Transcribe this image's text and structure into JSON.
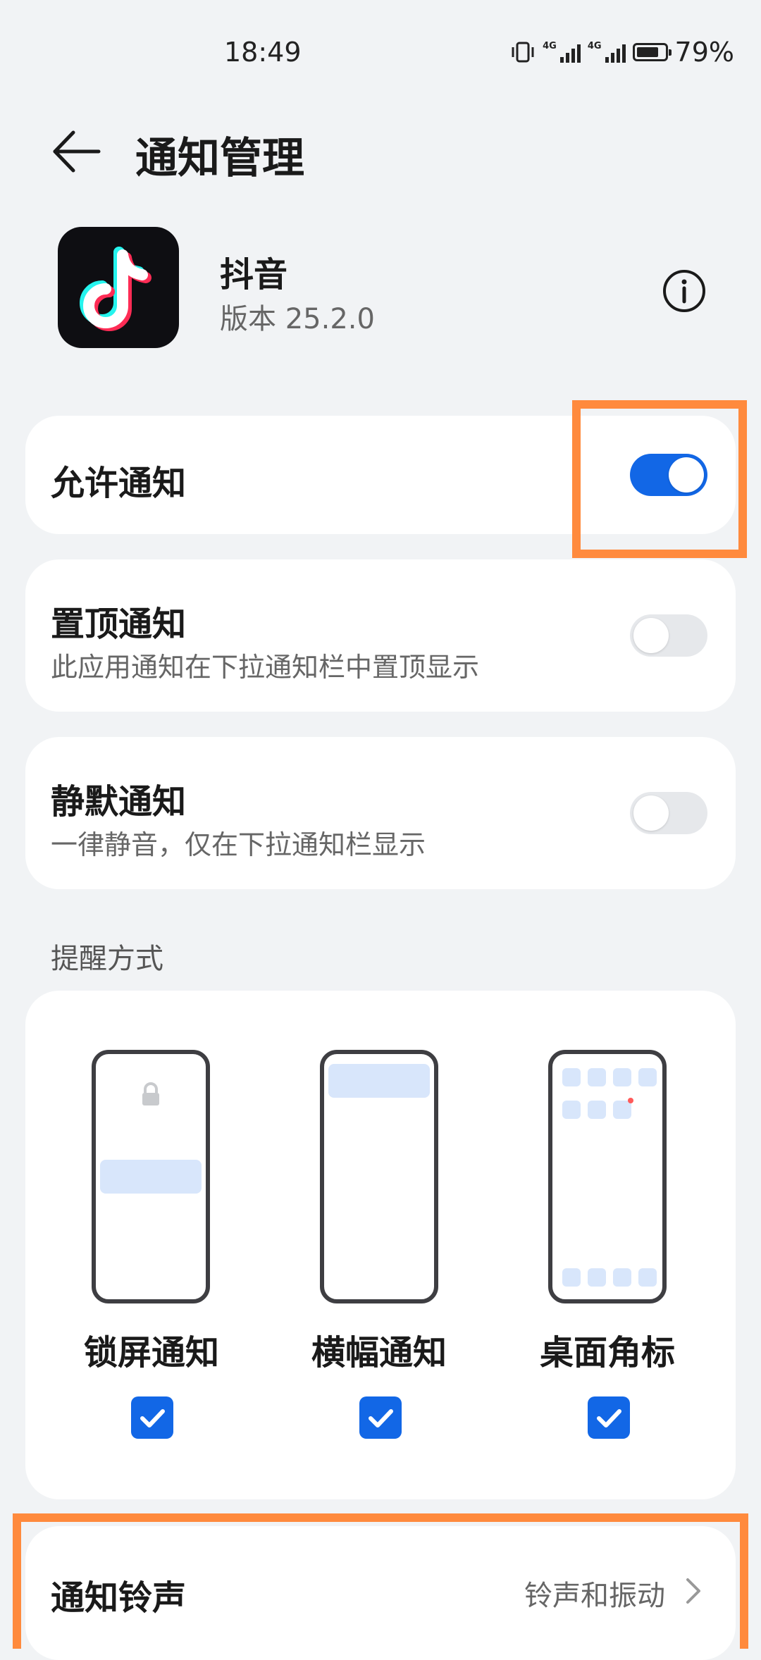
{
  "status_bar": {
    "time": "18:49",
    "net1": "4G",
    "net2": "4G",
    "battery": "79%"
  },
  "header": {
    "title": "通知管理"
  },
  "app": {
    "name": "抖音",
    "version": "版本 25.2.0"
  },
  "settings": {
    "allow": {
      "label": "允许通知",
      "enabled": true
    },
    "pinned": {
      "label": "置顶通知",
      "desc": "此应用通知在下拉通知栏中置顶显示",
      "enabled": false
    },
    "silent": {
      "label": "静默通知",
      "desc": "一律静音，仅在下拉通知栏显示",
      "enabled": false
    }
  },
  "reminder": {
    "section_label": "提醒方式",
    "options": [
      {
        "label": "锁屏通知",
        "checked": true
      },
      {
        "label": "横幅通知",
        "checked": true
      },
      {
        "label": "桌面角标",
        "checked": true
      }
    ]
  },
  "ringtone": {
    "label": "通知铃声",
    "value": "铃声和振动"
  },
  "colors": {
    "accent": "#1267e6",
    "highlight": "#ff8a3d",
    "background": "#f1f3f5"
  }
}
